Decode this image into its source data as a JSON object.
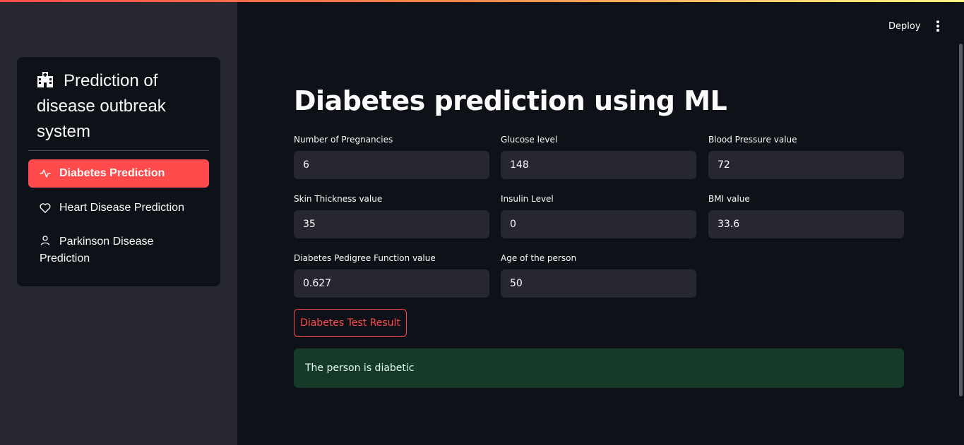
{
  "sidebar": {
    "menu_title": "Prediction of disease outbreak system",
    "title_icon": "hospital-icon",
    "items": [
      {
        "label": "Diabetes Prediction",
        "icon": "activity-icon",
        "active": true
      },
      {
        "label": "Heart Disease Prediction",
        "icon": "heart-icon",
        "active": false
      },
      {
        "label": "Parkinson Disease Prediction",
        "icon": "person-icon",
        "active": false
      }
    ]
  },
  "header": {
    "deploy_label": "Deploy",
    "menu_icon": "kebab-menu-icon"
  },
  "main": {
    "title": "Diabetes prediction using ML",
    "fields": [
      {
        "label": "Number of Pregnancies",
        "value": "6"
      },
      {
        "label": "Glucose level",
        "value": "148"
      },
      {
        "label": "Blood Pressure value",
        "value": "72"
      },
      {
        "label": "Skin Thickness value",
        "value": "35"
      },
      {
        "label": "Insulin Level",
        "value": "0"
      },
      {
        "label": "BMI value",
        "value": "33.6"
      },
      {
        "label": "Diabetes Pedigree Function value",
        "value": "0.627"
      },
      {
        "label": "Age of the person",
        "value": "50"
      }
    ],
    "button_label": "Diabetes Test Result",
    "result_text": "The person is diabetic"
  },
  "colors": {
    "accent": "#ff4b4b",
    "background": "#0e1117",
    "sidebar_bg": "#262730",
    "success_bg": "#173928"
  }
}
